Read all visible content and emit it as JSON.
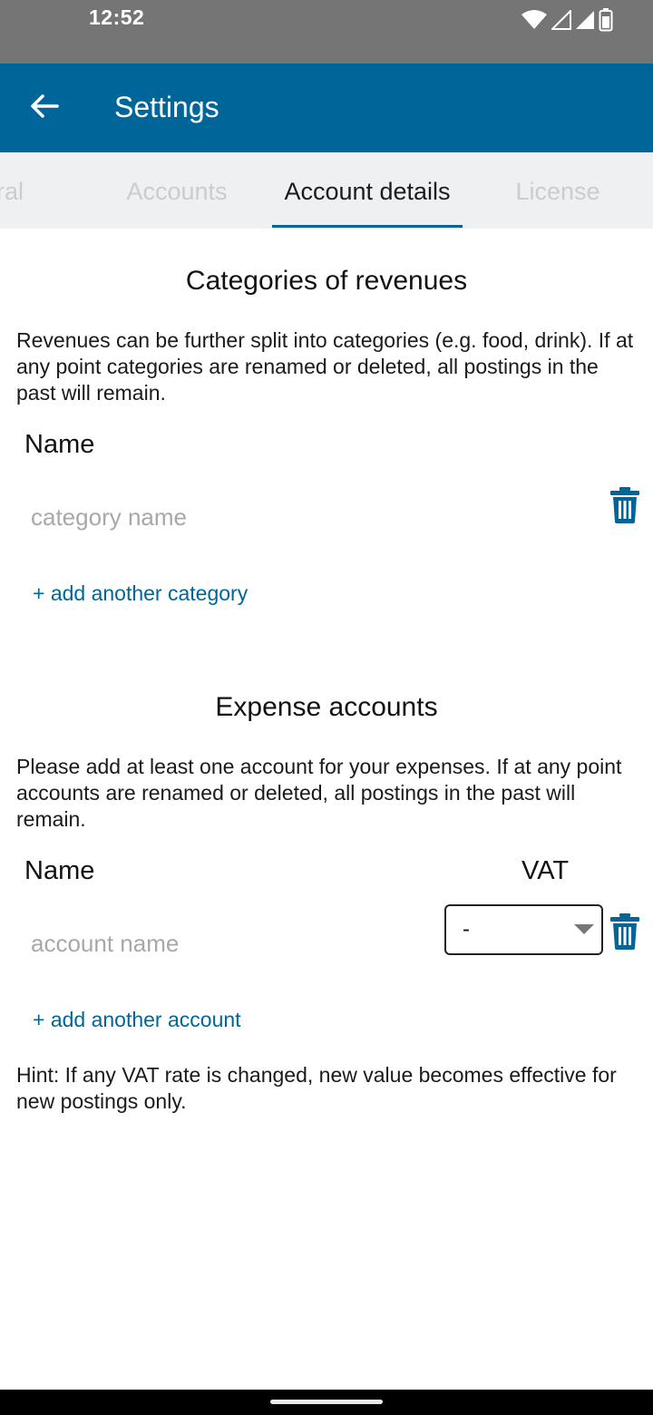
{
  "status_bar": {
    "time": "12:52",
    "icons": [
      "wifi-icon",
      "signal-icon",
      "signal-icon",
      "battery-icon"
    ]
  },
  "app_bar": {
    "title": "Settings",
    "back_icon": "arrow-left-icon",
    "color": "#006699"
  },
  "tabs": [
    {
      "label": "General",
      "visible_text": "ral",
      "active": false
    },
    {
      "label": "Accounts",
      "active": false
    },
    {
      "label": "Account details",
      "active": true
    },
    {
      "label": "License",
      "active": false
    }
  ],
  "revenues": {
    "title": "Categories of revenues",
    "description": "Revenues can be further split into categories (e.g. food, drink). If at any point categories are renamed or deleted, all postings in the past will remain.",
    "name_header": "Name",
    "name_value": "",
    "name_placeholder": "category name",
    "add_label": "+ add another category"
  },
  "expenses": {
    "title": "Expense accounts",
    "description": "Please add at least one account for your expenses. If at any point accounts are renamed or deleted, all postings in the past will remain.",
    "name_header": "Name",
    "vat_header": "VAT",
    "name_value": "",
    "name_placeholder": "account name",
    "vat_selected": "-",
    "add_label": "+ add another account"
  },
  "hint": "Hint: If any VAT rate is changed, new value becomes effective for new postings only.",
  "colors": {
    "accent": "#006699",
    "tab_bg": "#eef0f2",
    "status_bar": "#757575"
  }
}
